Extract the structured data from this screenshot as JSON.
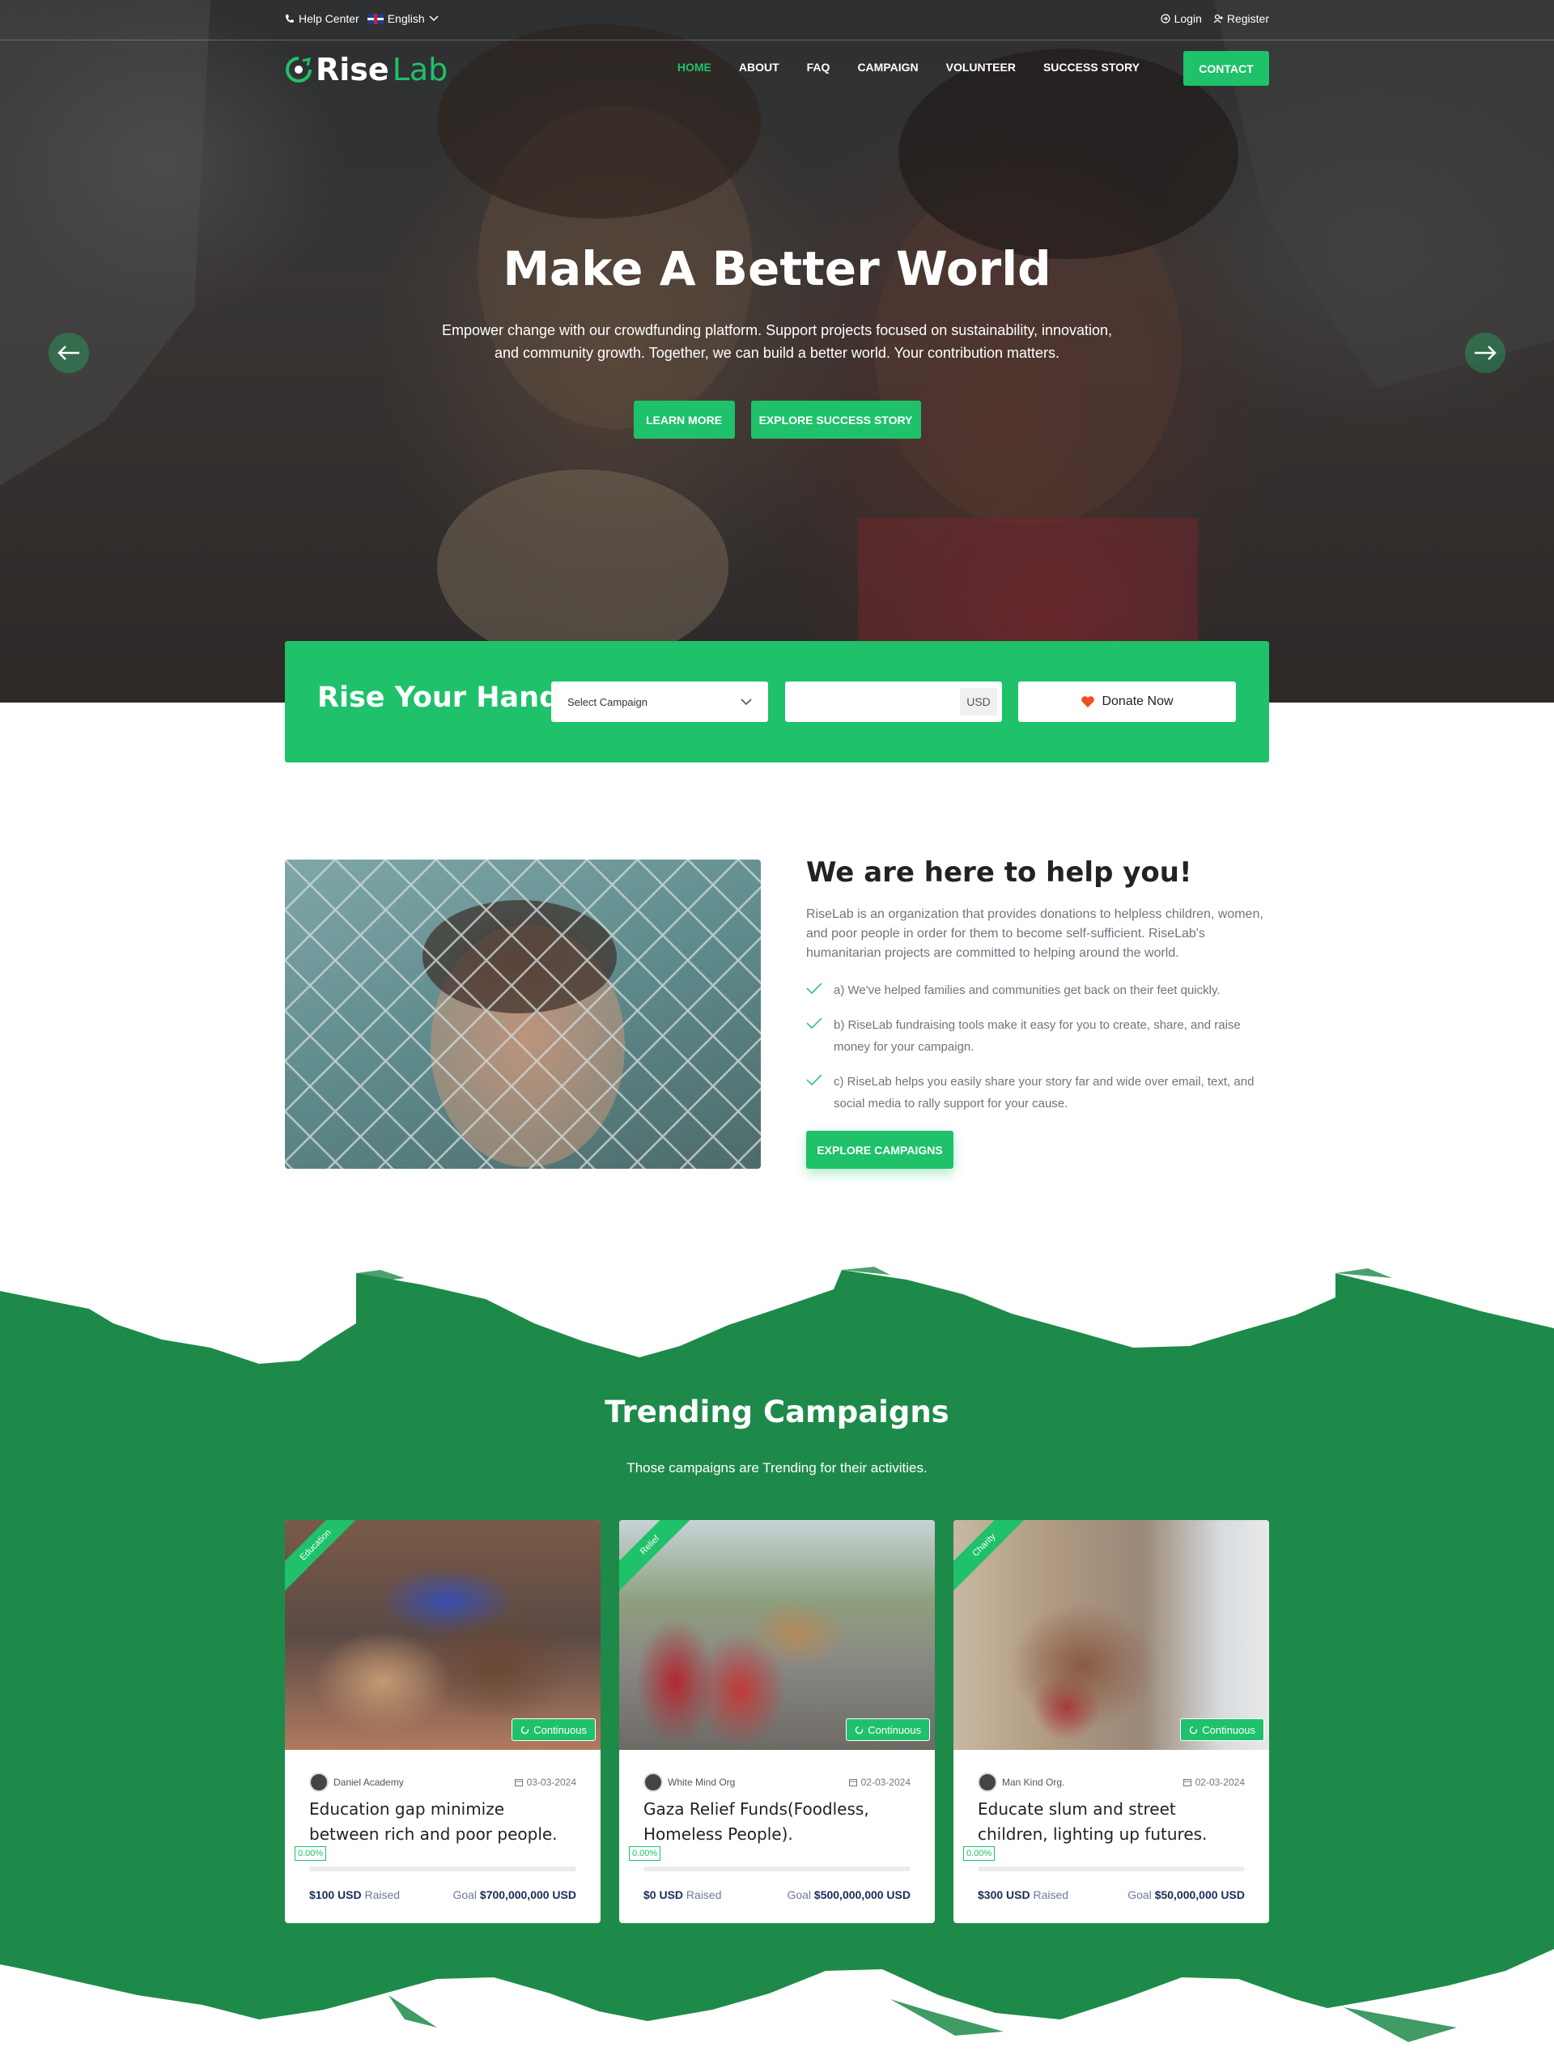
{
  "topbar": {
    "help_center": "Help Center",
    "language": "English",
    "login": "Login",
    "register": "Register"
  },
  "logo": {
    "part1": "Rise",
    "part2": "Lab"
  },
  "nav": {
    "items": [
      "HOME",
      "ABOUT",
      "FAQ",
      "CAMPAIGN",
      "VOLUNTEER",
      "SUCCESS STORY"
    ],
    "contact": "CONTACT"
  },
  "hero": {
    "title": "Make A Better World",
    "subtitle": "Empower change with our crowdfunding platform. Support projects focused on sustainability, innovation, and community growth. Together, we can build a better world. Your contribution matters.",
    "learn_more": "LEARN MORE",
    "explore_success": "EXPLORE SUCCESS STORY"
  },
  "donate": {
    "title": "Rise Your Hand",
    "select_placeholder": "Select Campaign",
    "currency": "USD",
    "button": "Donate Now"
  },
  "about": {
    "title": "We are here to help you!",
    "text": "RiseLab is an organization that provides donations to helpless children, women, and poor people in order for them to become self-sufficient. RiseLab's humanitarian projects are committed to helping around the world.",
    "points": [
      "a) We've helped families and communities get back on their feet quickly.",
      "b) RiseLab fundraising tools make it easy for you to create, share, and raise money for your campaign.",
      "c) RiseLab helps you easily share your story far and wide over email, text, and social media to rally support for your cause."
    ],
    "button": "EXPLORE CAMPAIGNS"
  },
  "trending": {
    "title": "Trending Campaigns",
    "subtitle": "Those campaigns are Trending for their activities.",
    "badge": "Continuous",
    "raised_label": "Raised",
    "goal_label": "Goal",
    "cards": [
      {
        "category": "Education",
        "author": "Daniel Academy",
        "date": "03-03-2024",
        "title": "Education gap minimize between rich and poor people.",
        "percent": "0.00%",
        "progress": 0,
        "raised": "$100 USD",
        "goal": "$700,000,000 USD"
      },
      {
        "category": "Relief",
        "author": "White Mind Org",
        "date": "02-03-2024",
        "title": "Gaza Relief Funds(Foodless, Homeless People).",
        "percent": "0.00%",
        "progress": 0,
        "raised": "$0 USD",
        "goal": "$500,000,000 USD"
      },
      {
        "category": "Charity",
        "author": "Man Kind Org.",
        "date": "02-03-2024",
        "title": "Educate slum and street children, lighting up futures.",
        "percent": "0.00%",
        "progress": 0,
        "raised": "$300 USD",
        "goal": "$50,000,000 USD"
      }
    ]
  },
  "colors": {
    "brand": "#1fc16b",
    "dark_green": "#1e8a4a",
    "navy": "#1a2c5b"
  }
}
